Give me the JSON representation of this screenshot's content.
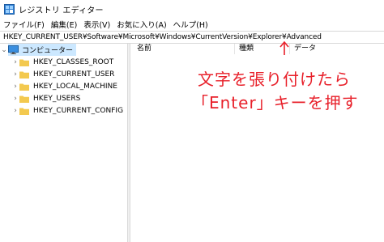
{
  "window": {
    "title": "レジストリ エディター"
  },
  "menu": {
    "items": [
      "ファイル(F)",
      "編集(E)",
      "表示(V)",
      "お気に入り(A)",
      "ヘルプ(H)"
    ]
  },
  "address": {
    "path": "HKEY_CURRENT_USER¥Software¥Microsoft¥Windows¥CurrentVersion¥Explorer¥Advanced"
  },
  "tree": {
    "root": "コンピューター",
    "keys": [
      "HKEY_CLASSES_ROOT",
      "HKEY_CURRENT_USER",
      "HKEY_LOCAL_MACHINE",
      "HKEY_USERS",
      "HKEY_CURRENT_CONFIG"
    ]
  },
  "list": {
    "columns": [
      "名前",
      "種類",
      "データ"
    ]
  },
  "annotation": {
    "line1": "文字を張り付けたら",
    "line2": "「Enter」キーを押す",
    "color": "#e8202a"
  },
  "colors": {
    "selection": "#cce8ff",
    "folder": "#f3c94f",
    "text": "#000000"
  }
}
